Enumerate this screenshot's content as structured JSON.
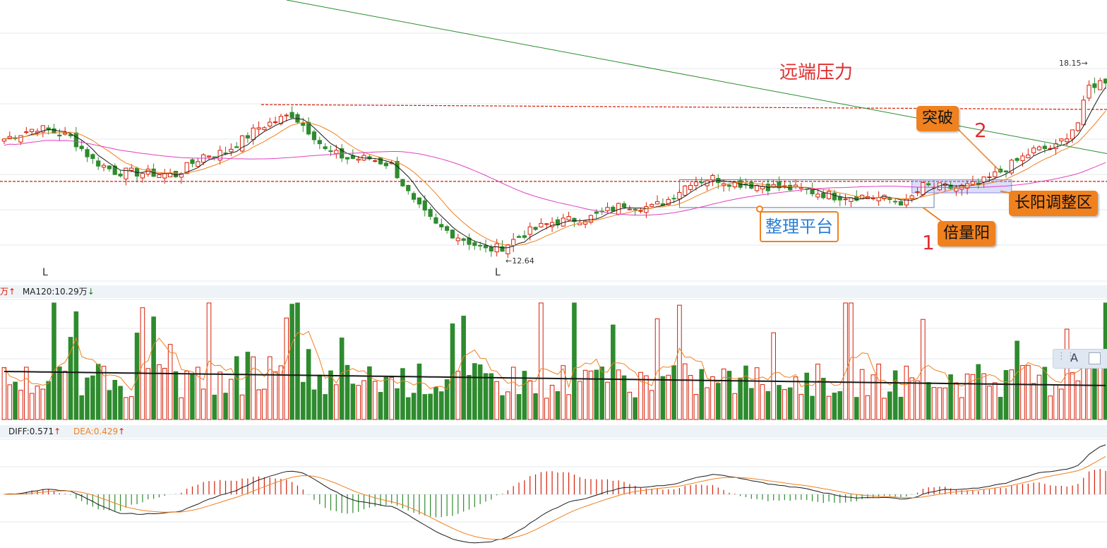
{
  "chart_data": [
    {
      "type": "candlestick",
      "title": "",
      "lines": [
        {
          "name": "",
          "color": "#1a1a1a"
        },
        {
          "name": "",
          "color": "#f0811f"
        },
        {
          "name": "",
          "color": "#e040c0"
        },
        {
          "name": "",
          "color": "#2e8b2e"
        }
      ],
      "ylim": [
        11.2,
        19.8
      ],
      "grid": true,
      "bar_count": 200,
      "close_path": [
        [
          0,
          15.55
        ],
        [
          6,
          15.9
        ],
        [
          12,
          15.6
        ],
        [
          16,
          14.9
        ],
        [
          20,
          14.55
        ],
        [
          26,
          14.5
        ],
        [
          31,
          14.45
        ],
        [
          36,
          15.05
        ],
        [
          40,
          15.15
        ],
        [
          46,
          15.9
        ],
        [
          52,
          16.3
        ],
        [
          56,
          15.65
        ],
        [
          58,
          15.2
        ],
        [
          62,
          14.95
        ],
        [
          66,
          14.95
        ],
        [
          70,
          14.75
        ],
        [
          74,
          13.6
        ],
        [
          78,
          12.9
        ],
        [
          84,
          12.4
        ],
        [
          87,
          12.15
        ],
        [
          90,
          12.25
        ],
        [
          94,
          12.65
        ],
        [
          99,
          13.0
        ],
        [
          106,
          13.15
        ],
        [
          112,
          13.55
        ],
        [
          117,
          13.45
        ],
        [
          120,
          13.7
        ],
        [
          124,
          14.25
        ],
        [
          128,
          14.35
        ],
        [
          132,
          14.2
        ],
        [
          138,
          14.1
        ],
        [
          144,
          14.0
        ],
        [
          150,
          13.8
        ],
        [
          156,
          13.8
        ],
        [
          163,
          13.6
        ],
        [
          166,
          14.1
        ],
        [
          172,
          14.05
        ],
        [
          176,
          14.15
        ],
        [
          180,
          14.55
        ],
        [
          186,
          15.2
        ],
        [
          190,
          15.3
        ],
        [
          194,
          16.05
        ],
        [
          196,
          17.15
        ],
        [
          199,
          17.35
        ]
      ],
      "annotations": [
        {
          "label": "low_1",
          "text": "L"
        },
        {
          "label": "low_2",
          "text": "L"
        },
        {
          "label": "low_value",
          "text": "←12.64"
        },
        {
          "label": "high_value",
          "text": "18.15→"
        },
        {
          "label": "resistance",
          "text": "远端压力"
        },
        {
          "label": "platform",
          "text": "整理平台"
        },
        {
          "label": "volume_up",
          "text": "倍量阳"
        },
        {
          "label": "breakout",
          "text": "突破"
        },
        {
          "label": "adjust_zone",
          "text": "长阳调整区"
        },
        {
          "label": "marker_1",
          "text": "1"
        },
        {
          "label": "marker_2",
          "text": "2"
        }
      ]
    },
    {
      "type": "bar",
      "title": "",
      "series": [
        {
          "name": "",
          "color": "#f0811f"
        },
        {
          "name": "MA120",
          "value": "10.29万",
          "color": "#1a1a1a"
        }
      ],
      "grid": true
    },
    {
      "type": "line",
      "title": "",
      "series": [
        {
          "name": "DIFF",
          "value": 0.571,
          "color": "#1a1a1a"
        },
        {
          "name": "DEA",
          "value": 0.429,
          "color": "#f0811f"
        }
      ],
      "histogram": "MACD"
    }
  ],
  "strip_volume": {
    "left_partial": "万",
    "left_arrow": "↑",
    "ma120_label": "MA120:10.29万",
    "ma120_arrow": "↓"
  },
  "strip_macd": {
    "diff_label": "DIFF:0.571",
    "diff_arrow": "↑",
    "dea_label": "DEA:0.429",
    "dea_arrow": "↑"
  },
  "labels": {
    "low_1": "L",
    "low_2": "L",
    "low_value": "←12.64",
    "high_value": "18.15→",
    "resistance": "远端压力",
    "platform": "整理平台",
    "volume_up": "倍量阳",
    "breakout": "突破",
    "adjust_zone": "长阳调整区",
    "marker_1": "1",
    "marker_2": "2"
  },
  "toolbar": {
    "grip_icon": "grip-icon",
    "text_tool": "A",
    "text_tool_icon": "text-tool-icon",
    "box_tool_icon": "checkbox-icon"
  },
  "colors": {
    "up": "#d81e06",
    "down": "#2e8b2e",
    "ma_black": "#1a1a1a",
    "ma_orange": "#f0811f",
    "ma_pink": "#e040c0",
    "ma_green": "#2e8b2e",
    "resistance_line": "#d81e06",
    "callout": "#f0811f"
  }
}
